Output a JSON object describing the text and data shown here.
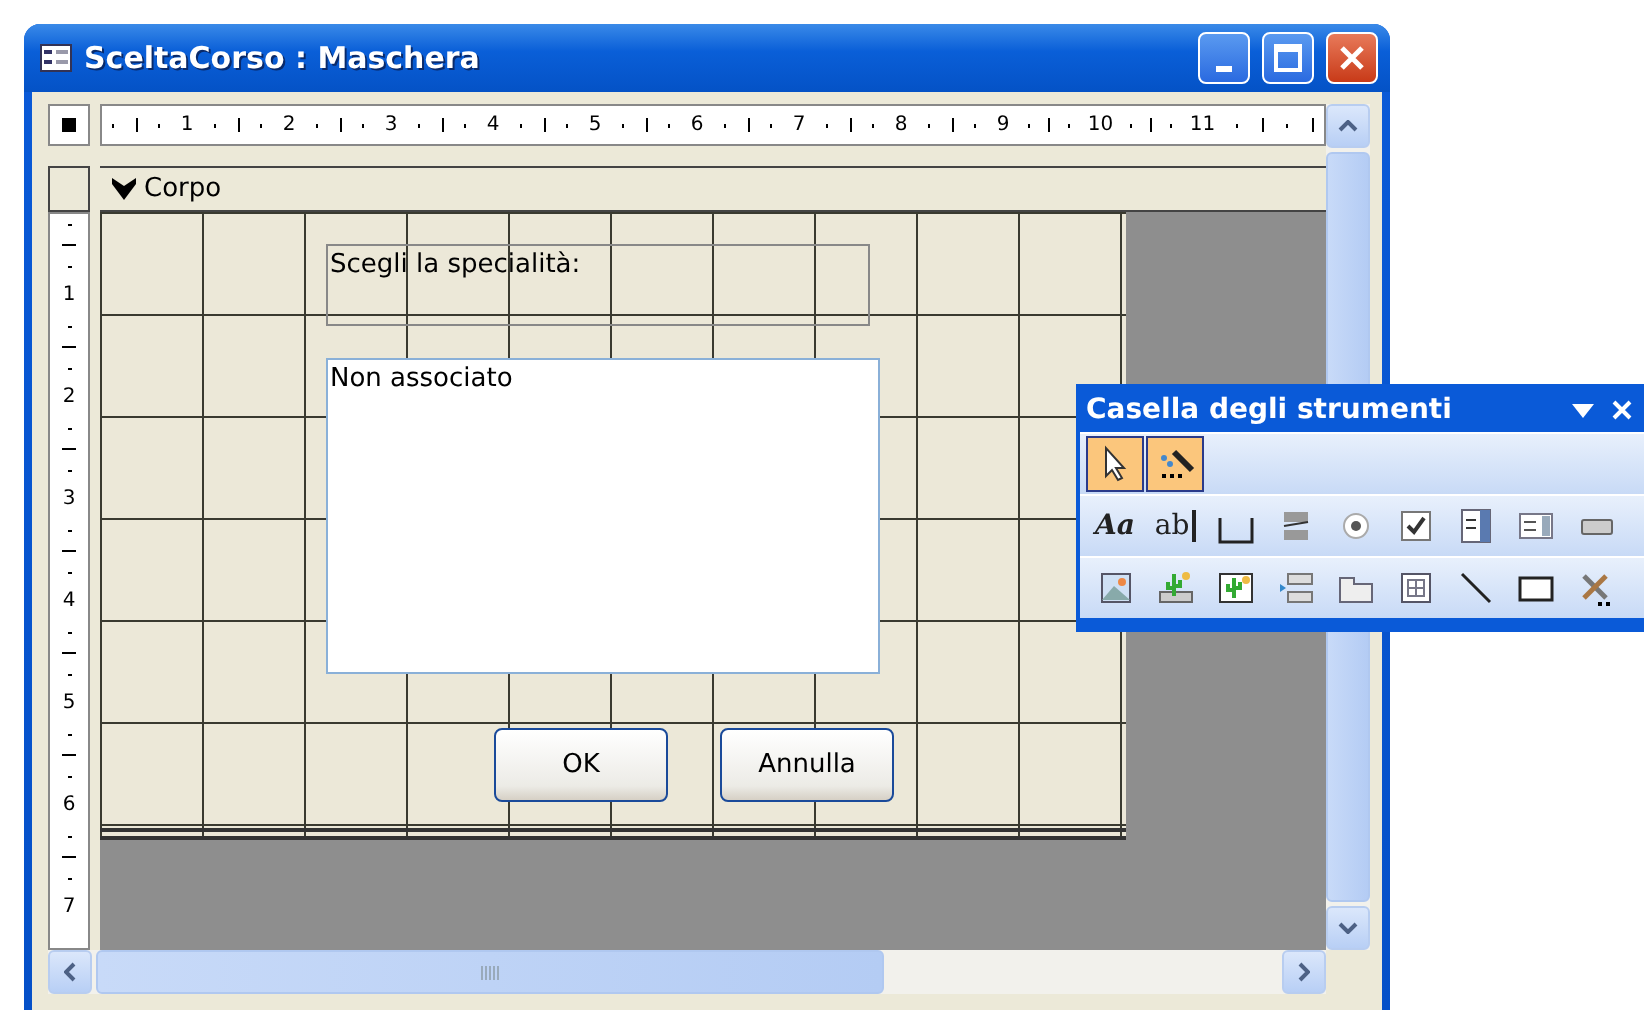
{
  "window": {
    "title": "SceltaCorso : Maschera"
  },
  "ruler": {
    "horizontal": [
      "1",
      "2",
      "3",
      "4",
      "5",
      "6",
      "7",
      "8",
      "9",
      "10",
      "11"
    ],
    "vertical": [
      "1",
      "2",
      "3",
      "4",
      "5",
      "6",
      "7"
    ]
  },
  "section": {
    "title": "Corpo"
  },
  "form": {
    "label": "Scegli la specialità:",
    "listbox": {
      "value": "Non associato"
    },
    "buttons": [
      "OK",
      "Annulla"
    ]
  },
  "toolbox": {
    "title": "Casella degli strumenti",
    "rows": [
      [
        {
          "kind": "pointer",
          "selected": true
        },
        {
          "kind": "wizard",
          "selected": true
        }
      ],
      [
        {
          "kind": "label",
          "glyph": "Aa",
          "selected": false
        },
        {
          "kind": "textbox",
          "glyph": "ab",
          "selected": false
        },
        {
          "kind": "group",
          "selected": false
        },
        {
          "kind": "toggle",
          "selected": false
        },
        {
          "kind": "radio",
          "selected": false
        },
        {
          "kind": "checkbox",
          "selected": false
        },
        {
          "kind": "combo",
          "selected": false
        },
        {
          "kind": "list",
          "selected": false
        },
        {
          "kind": "command",
          "selected": false
        }
      ],
      [
        {
          "kind": "image",
          "selected": false
        },
        {
          "kind": "unbound",
          "selected": false
        },
        {
          "kind": "bound",
          "selected": false
        },
        {
          "kind": "pagebreak",
          "selected": false
        },
        {
          "kind": "tab",
          "selected": false
        },
        {
          "kind": "subform",
          "selected": false
        },
        {
          "kind": "line",
          "selected": false
        },
        {
          "kind": "rectangle",
          "selected": false
        },
        {
          "kind": "more",
          "selected": false
        }
      ]
    ]
  }
}
